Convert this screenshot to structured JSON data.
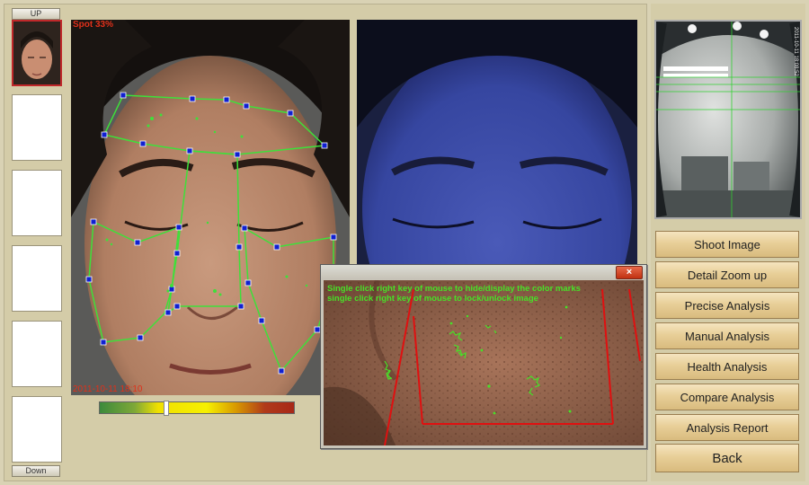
{
  "thumbnails": {
    "up_label": "UP",
    "down_label": "Down"
  },
  "main_view": {
    "spot_label": "Spot 33%",
    "timestamp": "2011-10-11 18:10"
  },
  "zoom_window": {
    "close_label": "×",
    "hint_line_1": "Single click right key of mouse to hide/display the color marks",
    "hint_line_2": "single click right key of mouse to lock/unlock image"
  },
  "camera": {
    "timestamp_vertical": "2011-10-11 18:08:52"
  },
  "menu": {
    "items": [
      {
        "label": "Shoot Image"
      },
      {
        "label": "Detail Zoom up"
      },
      {
        "label": "Precise Analysis"
      },
      {
        "label": "Manual Analysis"
      },
      {
        "label": "Health Analysis"
      },
      {
        "label": "Compare Analysis"
      },
      {
        "label": "Analysis Report"
      },
      {
        "label": "Back"
      }
    ]
  },
  "colors": {
    "mark_green": "#3ee03a",
    "region_blue": "#1020d0",
    "zoom_red": "#e01010",
    "menu_gold": "#e8cf98"
  },
  "color_scale": {
    "marker_position_percent": 33
  }
}
